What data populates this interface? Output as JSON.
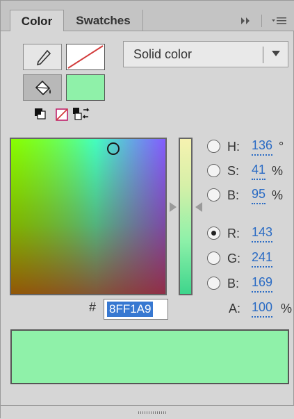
{
  "tabs": [
    {
      "label": "Color",
      "active": true
    },
    {
      "label": "Swatches",
      "active": false
    }
  ],
  "tab_icons": {
    "expand": "double-chevron-right-icon",
    "menu": "panel-menu-icon"
  },
  "fill_type": {
    "selected": "Solid color"
  },
  "stroke": {
    "color": "none"
  },
  "fill": {
    "color": "#8FF1A9"
  },
  "channels": [
    {
      "label": "H:",
      "value": "136",
      "unit": "°",
      "selected": false
    },
    {
      "label": "S:",
      "value": "41",
      "unit": "%",
      "selected": false
    },
    {
      "label": "B:",
      "value": "95",
      "unit": "%",
      "selected": false
    },
    {
      "label": "R:",
      "value": "143",
      "unit": "",
      "selected": true
    },
    {
      "label": "G:",
      "value": "241",
      "unit": "",
      "selected": false
    },
    {
      "label": "B:",
      "value": "169",
      "unit": "",
      "selected": false
    }
  ],
  "alpha": {
    "label": "A:",
    "value": "100",
    "unit": "%"
  },
  "hex": {
    "prefix": "#",
    "value": "8FF1A9"
  },
  "preview": {
    "color": "#8FF1A9"
  },
  "colors": {
    "accent_link": "#2a6bc4",
    "selection": "#3778d1",
    "panel_bg": "#d6d6d6"
  }
}
